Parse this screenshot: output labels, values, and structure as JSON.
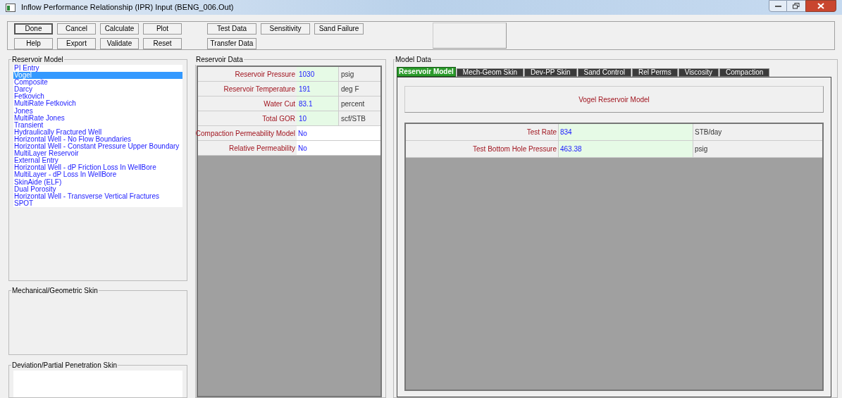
{
  "window": {
    "title": "Inflow Performance Relationship (IPR) Input (BENG_006.Out)"
  },
  "toolbar": {
    "button_rows": [
      [
        {
          "label": "Done",
          "default": true
        },
        {
          "label": "Cancel",
          "default": false
        },
        {
          "label": "Calculate",
          "default": false
        },
        {
          "label": "Plot",
          "default": false
        }
      ],
      [
        {
          "label": "Help",
          "default": false
        },
        {
          "label": "Export",
          "default": false
        },
        {
          "label": "Validate",
          "default": false
        },
        {
          "label": "Reset",
          "default": false
        }
      ]
    ],
    "extra_rows": [
      [
        {
          "label": "Test Data",
          "default": false
        },
        {
          "label": "Sensitivity",
          "default": false
        },
        {
          "label": "Sand Failure",
          "default": false
        }
      ],
      [
        {
          "label": "Transfer Data",
          "default": false
        }
      ]
    ]
  },
  "reservoir_model": {
    "title": "Reservoir Model",
    "items": [
      {
        "label": "PI Entry",
        "selected": false
      },
      {
        "label": "Vogel",
        "selected": true
      },
      {
        "label": "Composite",
        "selected": false
      },
      {
        "label": "Darcy",
        "selected": false
      },
      {
        "label": "Fetkovich",
        "selected": false
      },
      {
        "label": "MultiRate Fetkovich",
        "selected": false
      },
      {
        "label": "Jones",
        "selected": false
      },
      {
        "label": "MultiRate Jones",
        "selected": false
      },
      {
        "label": "Transient",
        "selected": false
      },
      {
        "label": "Hydraulically Fractured Well",
        "selected": false
      },
      {
        "label": "Horizontal Well - No Flow Boundaries",
        "selected": false
      },
      {
        "label": "Horizontal Well - Constant Pressure Upper Boundary",
        "selected": false
      },
      {
        "label": "MultiLayer Reservoir",
        "selected": false
      },
      {
        "label": "External Entry",
        "selected": false
      },
      {
        "label": "Horizontal Well - dP Friction Loss In WellBore",
        "selected": false
      },
      {
        "label": "MultiLayer - dP Loss In WellBore",
        "selected": false
      },
      {
        "label": "SkinAide (ELF)",
        "selected": false
      },
      {
        "label": "Dual Porosity",
        "selected": false
      },
      {
        "label": "Horizontal Well - Transverse Vertical Fractures",
        "selected": false
      },
      {
        "label": "SPOT",
        "selected": false
      }
    ]
  },
  "mechanical_skin": {
    "title": "Mechanical/Geometric Skin"
  },
  "deviation_skin": {
    "title": "Deviation/Partial Penetration Skin"
  },
  "reservoir_data": {
    "title": "Reservoir Data",
    "rows": [
      {
        "kind": "numeric",
        "label": "Reservoir Pressure",
        "value": "1030",
        "unit": "psig"
      },
      {
        "kind": "numeric",
        "label": "Reservoir Temperature",
        "value": "191",
        "unit": "deg F"
      },
      {
        "kind": "numeric",
        "label": "Water Cut",
        "value": "83.1",
        "unit": "percent"
      },
      {
        "kind": "numeric",
        "label": "Total GOR",
        "value": "10",
        "unit": "scf/STB"
      },
      {
        "kind": "option",
        "label": "Compaction Permeability Model",
        "value": "No"
      },
      {
        "kind": "option",
        "label": "Relative Permeability",
        "value": "No"
      }
    ]
  },
  "model_data": {
    "title": "Model Data",
    "tabs": [
      {
        "label": "Reservoir Model",
        "selected": true
      },
      {
        "label": "Mech-Geom Skin",
        "selected": false
      },
      {
        "label": "Dev-PP Skin",
        "selected": false
      },
      {
        "label": "Sand Control",
        "selected": false
      },
      {
        "label": "Rel Perms",
        "selected": false
      },
      {
        "label": "Viscosity",
        "selected": false
      },
      {
        "label": "Compaction",
        "selected": false
      }
    ],
    "heading": "Vogel Reservoir Model",
    "rows": [
      {
        "label": "Test Rate",
        "value": "834",
        "unit": "STB/day"
      },
      {
        "label": "Test Bottom Hole Pressure",
        "value": "463.38",
        "unit": "psig"
      }
    ]
  }
}
